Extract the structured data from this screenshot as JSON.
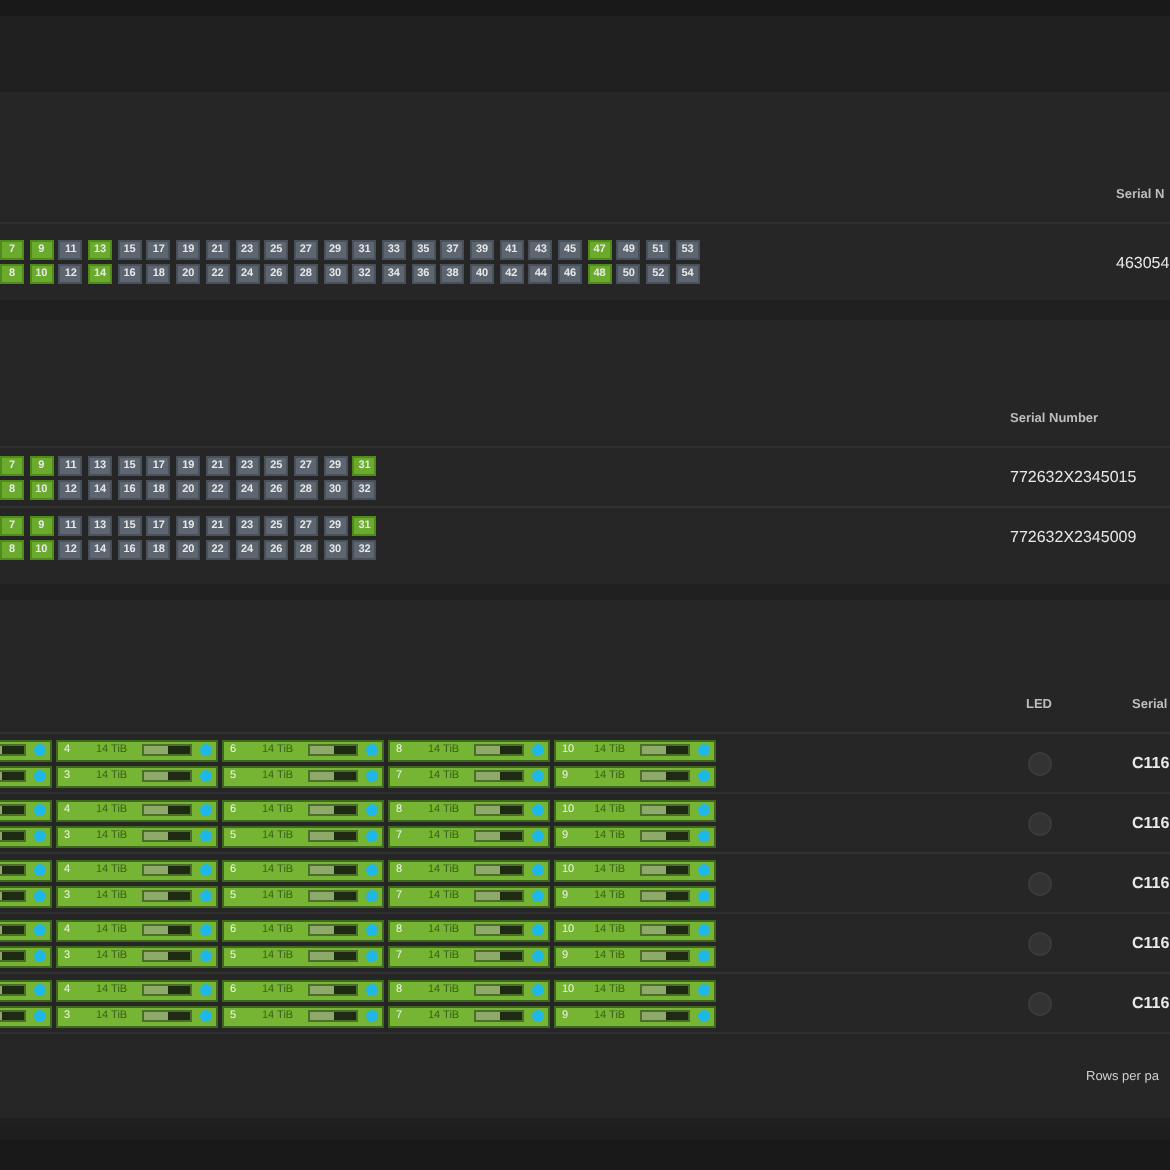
{
  "switch_table_a": {
    "column": "Serial N",
    "rows": [
      {
        "serial": "463054",
        "port_lines": [
          [
            {
              "label": "7",
              "linked": true
            },
            {
              "label": "9",
              "linked": true
            },
            {
              "label": "11",
              "linked": false
            },
            {
              "label": "13",
              "linked": true
            },
            {
              "label": "15",
              "linked": false
            },
            {
              "label": "17",
              "linked": false
            },
            {
              "label": "19",
              "linked": false
            },
            {
              "label": "21",
              "linked": false
            },
            {
              "label": "23",
              "linked": false
            },
            {
              "label": "25",
              "linked": false
            },
            {
              "label": "27",
              "linked": false
            },
            {
              "label": "29",
              "linked": false
            },
            {
              "label": "31",
              "linked": false
            },
            {
              "label": "33",
              "linked": false
            },
            {
              "label": "35",
              "linked": false
            },
            {
              "label": "37",
              "linked": false
            },
            {
              "label": "39",
              "linked": false
            },
            {
              "label": "41",
              "linked": false
            },
            {
              "label": "43",
              "linked": false
            },
            {
              "label": "45",
              "linked": false
            },
            {
              "label": "47",
              "linked": true
            },
            {
              "label": "49",
              "linked": false
            },
            {
              "label": "51",
              "linked": false
            },
            {
              "label": "53",
              "linked": false
            }
          ],
          [
            {
              "label": "8",
              "linked": true
            },
            {
              "label": "10",
              "linked": true
            },
            {
              "label": "12",
              "linked": false
            },
            {
              "label": "14",
              "linked": true
            },
            {
              "label": "16",
              "linked": false
            },
            {
              "label": "18",
              "linked": false
            },
            {
              "label": "20",
              "linked": false
            },
            {
              "label": "22",
              "linked": false
            },
            {
              "label": "24",
              "linked": false
            },
            {
              "label": "26",
              "linked": false
            },
            {
              "label": "28",
              "linked": false
            },
            {
              "label": "30",
              "linked": false
            },
            {
              "label": "32",
              "linked": false
            },
            {
              "label": "34",
              "linked": false
            },
            {
              "label": "36",
              "linked": false
            },
            {
              "label": "38",
              "linked": false
            },
            {
              "label": "40",
              "linked": false
            },
            {
              "label": "42",
              "linked": false
            },
            {
              "label": "44",
              "linked": false
            },
            {
              "label": "46",
              "linked": false
            },
            {
              "label": "48",
              "linked": true
            },
            {
              "label": "50",
              "linked": false
            },
            {
              "label": "52",
              "linked": false
            },
            {
              "label": "54",
              "linked": false
            }
          ]
        ]
      }
    ]
  },
  "switch_table_b": {
    "column": "Serial Number",
    "rows": [
      {
        "serial": "772632X2345015",
        "port_lines": [
          [
            {
              "label": "7",
              "linked": true
            },
            {
              "label": "9",
              "linked": true
            },
            {
              "label": "11",
              "linked": false
            },
            {
              "label": "13",
              "linked": false
            },
            {
              "label": "15",
              "linked": false
            },
            {
              "label": "17",
              "linked": false
            },
            {
              "label": "19",
              "linked": false
            },
            {
              "label": "21",
              "linked": false
            },
            {
              "label": "23",
              "linked": false
            },
            {
              "label": "25",
              "linked": false
            },
            {
              "label": "27",
              "linked": false
            },
            {
              "label": "29",
              "linked": false
            },
            {
              "label": "31",
              "linked": true
            }
          ],
          [
            {
              "label": "8",
              "linked": true
            },
            {
              "label": "10",
              "linked": true
            },
            {
              "label": "12",
              "linked": false
            },
            {
              "label": "14",
              "linked": false
            },
            {
              "label": "16",
              "linked": false
            },
            {
              "label": "18",
              "linked": false
            },
            {
              "label": "20",
              "linked": false
            },
            {
              "label": "22",
              "linked": false
            },
            {
              "label": "24",
              "linked": false
            },
            {
              "label": "26",
              "linked": false
            },
            {
              "label": "28",
              "linked": false
            },
            {
              "label": "30",
              "linked": false
            },
            {
              "label": "32",
              "linked": false
            }
          ]
        ]
      },
      {
        "serial": "772632X2345009",
        "port_lines": [
          [
            {
              "label": "7",
              "linked": true
            },
            {
              "label": "9",
              "linked": true
            },
            {
              "label": "11",
              "linked": false
            },
            {
              "label": "13",
              "linked": false
            },
            {
              "label": "15",
              "linked": false
            },
            {
              "label": "17",
              "linked": false
            },
            {
              "label": "19",
              "linked": false
            },
            {
              "label": "21",
              "linked": false
            },
            {
              "label": "23",
              "linked": false
            },
            {
              "label": "25",
              "linked": false
            },
            {
              "label": "27",
              "linked": false
            },
            {
              "label": "29",
              "linked": false
            },
            {
              "label": "31",
              "linked": true
            }
          ],
          [
            {
              "label": "8",
              "linked": true
            },
            {
              "label": "10",
              "linked": true
            },
            {
              "label": "12",
              "linked": false
            },
            {
              "label": "14",
              "linked": false
            },
            {
              "label": "16",
              "linked": false
            },
            {
              "label": "18",
              "linked": false
            },
            {
              "label": "20",
              "linked": false
            },
            {
              "label": "22",
              "linked": false
            },
            {
              "label": "24",
              "linked": false
            },
            {
              "label": "26",
              "linked": false
            },
            {
              "label": "28",
              "linked": false
            },
            {
              "label": "30",
              "linked": false
            },
            {
              "label": "32",
              "linked": false
            }
          ]
        ]
      }
    ]
  },
  "enclosure_table": {
    "columns": [
      "LED",
      "Serial"
    ],
    "footer": "Rows per pa",
    "rows": [
      {
        "led_on": false,
        "serial": "C116",
        "drive_lines": [
          [
            {
              "kind": "partial",
              "level": 0.5
            },
            {
              "kind": "full",
              "bay": "4",
              "capacity": "14 TiB",
              "level": 0.5
            },
            {
              "kind": "full",
              "bay": "6",
              "capacity": "14 TiB",
              "level": 0.5
            },
            {
              "kind": "full",
              "bay": "8",
              "capacity": "14 TiB",
              "level": 0.5
            },
            {
              "kind": "full",
              "bay": "10",
              "capacity": "14 TiB",
              "level": 0.5
            }
          ],
          [
            {
              "kind": "partial",
              "level": 0.5
            },
            {
              "kind": "full",
              "bay": "3",
              "capacity": "14 TiB",
              "level": 0.5
            },
            {
              "kind": "full",
              "bay": "5",
              "capacity": "14 TiB",
              "level": 0.5
            },
            {
              "kind": "full",
              "bay": "7",
              "capacity": "14 TiB",
              "level": 0.5
            },
            {
              "kind": "full",
              "bay": "9",
              "capacity": "14 TiB",
              "level": 0.5
            }
          ]
        ]
      },
      {
        "led_on": false,
        "serial": "C116",
        "drive_lines": [
          [
            {
              "kind": "partial",
              "level": 0.5
            },
            {
              "kind": "full",
              "bay": "4",
              "capacity": "14 TiB",
              "level": 0.5
            },
            {
              "kind": "full",
              "bay": "6",
              "capacity": "14 TiB",
              "level": 0.5
            },
            {
              "kind": "full",
              "bay": "8",
              "capacity": "14 TiB",
              "level": 0.5
            },
            {
              "kind": "full",
              "bay": "10",
              "capacity": "14 TiB",
              "level": 0.5
            }
          ],
          [
            {
              "kind": "partial",
              "level": 0.5
            },
            {
              "kind": "full",
              "bay": "3",
              "capacity": "14 TiB",
              "level": 0.5
            },
            {
              "kind": "full",
              "bay": "5",
              "capacity": "14 TiB",
              "level": 0.5
            },
            {
              "kind": "full",
              "bay": "7",
              "capacity": "14 TiB",
              "level": 0.5
            },
            {
              "kind": "full",
              "bay": "9",
              "capacity": "14 TiB",
              "level": 0.5
            }
          ]
        ]
      },
      {
        "led_on": false,
        "serial": "C116",
        "drive_lines": [
          [
            {
              "kind": "partial",
              "level": 0.5
            },
            {
              "kind": "full",
              "bay": "4",
              "capacity": "14 TiB",
              "level": 0.5
            },
            {
              "kind": "full",
              "bay": "6",
              "capacity": "14 TiB",
              "level": 0.5
            },
            {
              "kind": "full",
              "bay": "8",
              "capacity": "14 TiB",
              "level": 0.5
            },
            {
              "kind": "full",
              "bay": "10",
              "capacity": "14 TiB",
              "level": 0.5
            }
          ],
          [
            {
              "kind": "partial",
              "level": 0.5
            },
            {
              "kind": "full",
              "bay": "3",
              "capacity": "14 TiB",
              "level": 0.5
            },
            {
              "kind": "full",
              "bay": "5",
              "capacity": "14 TiB",
              "level": 0.5
            },
            {
              "kind": "full",
              "bay": "7",
              "capacity": "14 TiB",
              "level": 0.5
            },
            {
              "kind": "full",
              "bay": "9",
              "capacity": "14 TiB",
              "level": 0.5
            }
          ]
        ]
      },
      {
        "led_on": false,
        "serial": "C116",
        "drive_lines": [
          [
            {
              "kind": "partial",
              "level": 0.5
            },
            {
              "kind": "full",
              "bay": "4",
              "capacity": "14 TiB",
              "level": 0.5
            },
            {
              "kind": "full",
              "bay": "6",
              "capacity": "14 TiB",
              "level": 0.5
            },
            {
              "kind": "full",
              "bay": "8",
              "capacity": "14 TiB",
              "level": 0.5
            },
            {
              "kind": "full",
              "bay": "10",
              "capacity": "14 TiB",
              "level": 0.5
            }
          ],
          [
            {
              "kind": "partial",
              "level": 0.5
            },
            {
              "kind": "full",
              "bay": "3",
              "capacity": "14 TiB",
              "level": 0.5
            },
            {
              "kind": "full",
              "bay": "5",
              "capacity": "14 TiB",
              "level": 0.5
            },
            {
              "kind": "full",
              "bay": "7",
              "capacity": "14 TiB",
              "level": 0.5
            },
            {
              "kind": "full",
              "bay": "9",
              "capacity": "14 TiB",
              "level": 0.5
            }
          ]
        ]
      },
      {
        "led_on": false,
        "serial": "C116",
        "drive_lines": [
          [
            {
              "kind": "partial",
              "level": 0.5
            },
            {
              "kind": "full",
              "bay": "4",
              "capacity": "14 TiB",
              "level": 0.5
            },
            {
              "kind": "full",
              "bay": "6",
              "capacity": "14 TiB",
              "level": 0.5
            },
            {
              "kind": "full",
              "bay": "8",
              "capacity": "14 TiB",
              "level": 0.5
            },
            {
              "kind": "full",
              "bay": "10",
              "capacity": "14 TiB",
              "level": 0.5
            }
          ],
          [
            {
              "kind": "partial",
              "level": 0.5
            },
            {
              "kind": "full",
              "bay": "3",
              "capacity": "14 TiB",
              "level": 0.5
            },
            {
              "kind": "full",
              "bay": "5",
              "capacity": "14 TiB",
              "level": 0.5
            },
            {
              "kind": "full",
              "bay": "7",
              "capacity": "14 TiB",
              "level": 0.5
            },
            {
              "kind": "full",
              "bay": "9",
              "capacity": "14 TiB",
              "level": 0.5
            }
          ]
        ]
      }
    ]
  }
}
